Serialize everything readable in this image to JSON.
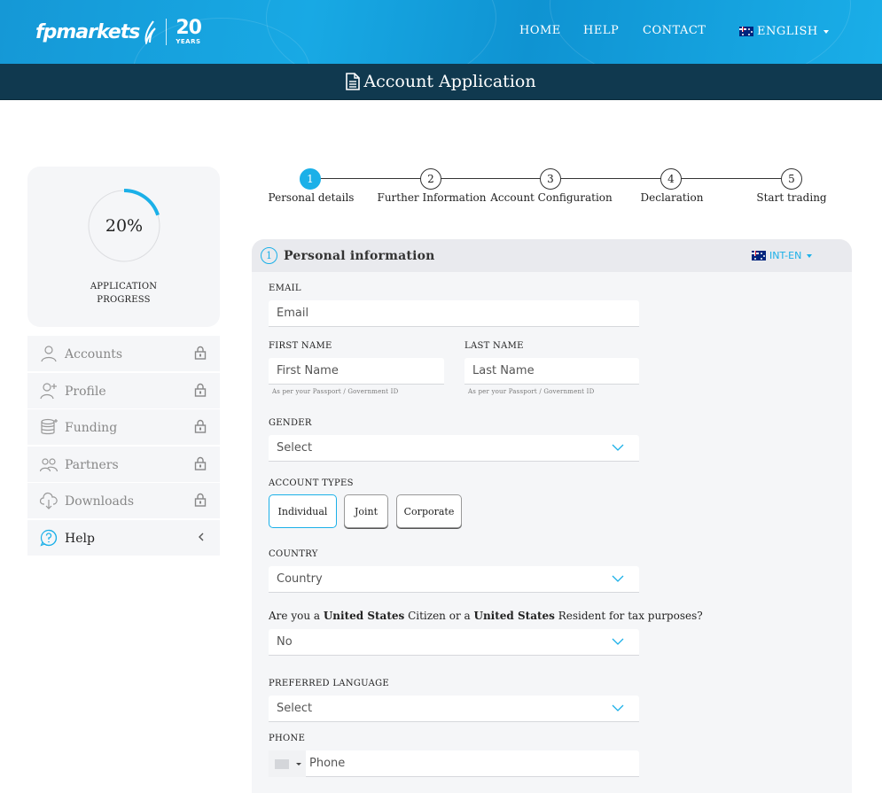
{
  "header": {
    "logo_text": "fpmarkets",
    "logo_years_number": "20",
    "logo_years_label": "YEARS",
    "nav": {
      "home": "HOME",
      "help": "HELP",
      "contact": "CONTACT"
    },
    "language": "ENGLISH"
  },
  "title_bar": {
    "title": "Account Application"
  },
  "progress": {
    "percent_label": "20%",
    "percent_value": 20,
    "label_line1": "APPLICATION",
    "label_line2": "PROGRESS",
    "accent_color": "#1bb0e8"
  },
  "sidebar": {
    "items": [
      {
        "label": "Accounts",
        "icon": "user-icon",
        "locked": true
      },
      {
        "label": "Profile",
        "icon": "user-plus-icon",
        "locked": true
      },
      {
        "label": "Funding",
        "icon": "coins-icon",
        "locked": true
      },
      {
        "label": "Partners",
        "icon": "partners-icon",
        "locked": true
      },
      {
        "label": "Downloads",
        "icon": "cloud-download-icon",
        "locked": true
      },
      {
        "label": "Help",
        "icon": "question-icon",
        "locked": false
      }
    ]
  },
  "stepper": {
    "steps": [
      {
        "number": "1",
        "label": "Personal details",
        "active": true
      },
      {
        "number": "2",
        "label": "Further Information",
        "active": false
      },
      {
        "number": "3",
        "label": "Account Configuration",
        "active": false
      },
      {
        "number": "4",
        "label": "Declaration",
        "active": false
      },
      {
        "number": "5",
        "label": "Start trading",
        "active": false
      }
    ]
  },
  "form": {
    "section_number": "1",
    "section_title": "Personal information",
    "region_language": "INT-EN",
    "email": {
      "label": "EMAIL",
      "placeholder": "Email"
    },
    "first_name": {
      "label": "FIRST NAME",
      "placeholder": "First Name",
      "hint": "As per your Passport / Government ID"
    },
    "last_name": {
      "label": "LAST NAME",
      "placeholder": "Last Name",
      "hint": "As per your Passport / Government ID"
    },
    "gender": {
      "label": "GENDER",
      "value": "Select"
    },
    "account_types": {
      "label": "ACCOUNT TYPES",
      "options": [
        "Individual",
        "Joint",
        "Corporate"
      ],
      "selected": "Individual"
    },
    "country": {
      "label": "COUNTRY",
      "value": "Country"
    },
    "us_question": {
      "part1": "Are you a ",
      "us1": "United States",
      "part2": " Citizen or a ",
      "us2": "United States",
      "part3": " Resident for tax purposes?",
      "value": "No"
    },
    "preferred_language": {
      "label": "PREFERRED LANGUAGE",
      "value": "Select"
    },
    "phone": {
      "label": "PHONE",
      "placeholder": "Phone"
    }
  }
}
